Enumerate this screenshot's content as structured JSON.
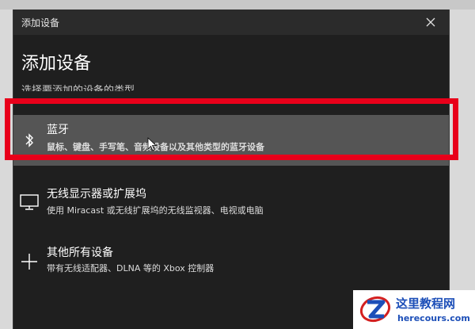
{
  "window": {
    "title": "添加设备",
    "close_symbol": "✕",
    "heading": "添加设备",
    "subheading": "选择要添加的设备的类型"
  },
  "options": [
    {
      "icon": "bluetooth-icon",
      "label": "蓝牙",
      "description": "鼠标、键盘、手写笔、音频设备以及其他类型的蓝牙设备",
      "selected": true
    },
    {
      "icon": "monitor-icon",
      "label": "无线显示器或扩展坞",
      "description": "使用 Miracast 或无线扩展坞的无线监视器、电视或电脑",
      "selected": false
    },
    {
      "icon": "plus-icon",
      "label": "其他所有设备",
      "description": "带有无线适配器、DLNA 等的 Xbox 控制器",
      "selected": false
    }
  ],
  "watermark": {
    "name": "这里教程网",
    "url": "herecours.com"
  },
  "colors": {
    "window_bg": "#1f1f1f",
    "selected_bg": "#555555",
    "highlight": "#e8001a",
    "watermark_blue": "#1d4fb8"
  }
}
